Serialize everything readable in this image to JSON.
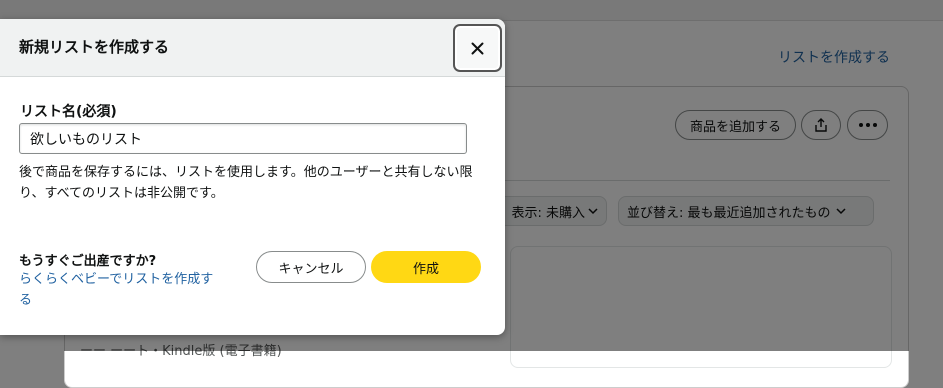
{
  "background": {
    "create_list_link": "リストを作成する",
    "add_item_button": "商品を追加する",
    "filter_label": "表示: 未購入",
    "sort_label": "並び替え: 最も最近追加されたもの",
    "item_format_text": "ーー ーート・Kindle版 (電子書籍)"
  },
  "modal": {
    "title": "新規リストを作成する",
    "close_icon": "close-icon",
    "field_label": "リスト名(必須)",
    "list_name_value": "欲しいものリスト",
    "help_text": "後で商品を保存するには、リストを使用します。他のユーザーと共有しない限り、すべてのリストは非公開です。",
    "baby_question": "もうすぐご出産ですか?",
    "baby_link": "らくらくベビーでリストを作成する",
    "cancel_label": "キャンセル",
    "create_label": "作成"
  },
  "colors": {
    "create_button": "#ffd814",
    "link": "#2162a1",
    "header_bg": "#f0f2f2"
  }
}
